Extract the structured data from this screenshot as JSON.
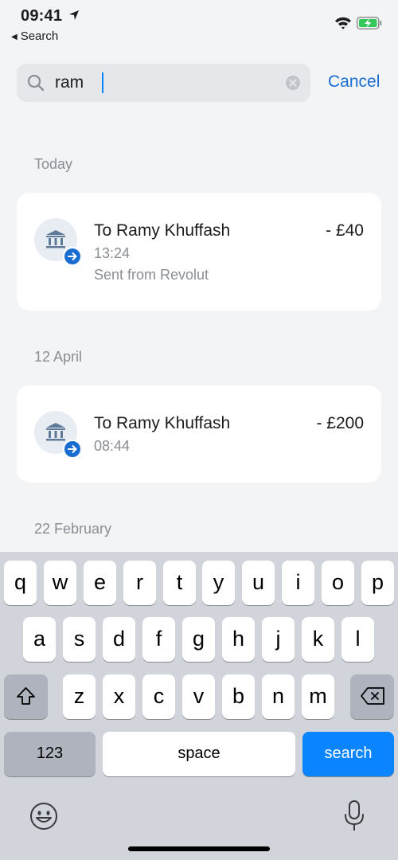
{
  "status_bar": {
    "time": "09:41",
    "back_label": "Search"
  },
  "search": {
    "value": "ram",
    "cancel_label": "Cancel"
  },
  "sections": [
    {
      "label": "Today",
      "transactions": [
        {
          "title": "To Ramy Khuffash",
          "time": "13:24",
          "note": "Sent from Revolut",
          "amount": "- £40"
        }
      ]
    },
    {
      "label": "12 April",
      "transactions": [
        {
          "title": "To Ramy Khuffash",
          "time": "08:44",
          "amount": "- £200"
        }
      ]
    },
    {
      "label": "22 February",
      "transactions": []
    }
  ],
  "keyboard": {
    "row1": [
      "q",
      "w",
      "e",
      "r",
      "t",
      "y",
      "u",
      "i",
      "o",
      "p"
    ],
    "row2": [
      "a",
      "s",
      "d",
      "f",
      "g",
      "h",
      "j",
      "k",
      "l"
    ],
    "row3": [
      "z",
      "x",
      "c",
      "v",
      "b",
      "n",
      "m"
    ],
    "numbers_label": "123",
    "space_label": "space",
    "search_label": "search"
  },
  "colors": {
    "accent": "#1a6dd0",
    "search_key": "#0a84ff",
    "background": "#f3f4f6",
    "battery_fill": "#34c759"
  },
  "icons": {
    "location": "location-arrow-icon",
    "wifi": "wifi-icon",
    "battery": "battery-charging-icon",
    "search": "search-icon",
    "clear": "clear-icon",
    "bank": "bank-icon",
    "outgoing": "arrow-right-icon",
    "shift": "shift-icon",
    "backspace": "backspace-icon",
    "emoji": "emoji-icon",
    "mic": "microphone-icon"
  }
}
